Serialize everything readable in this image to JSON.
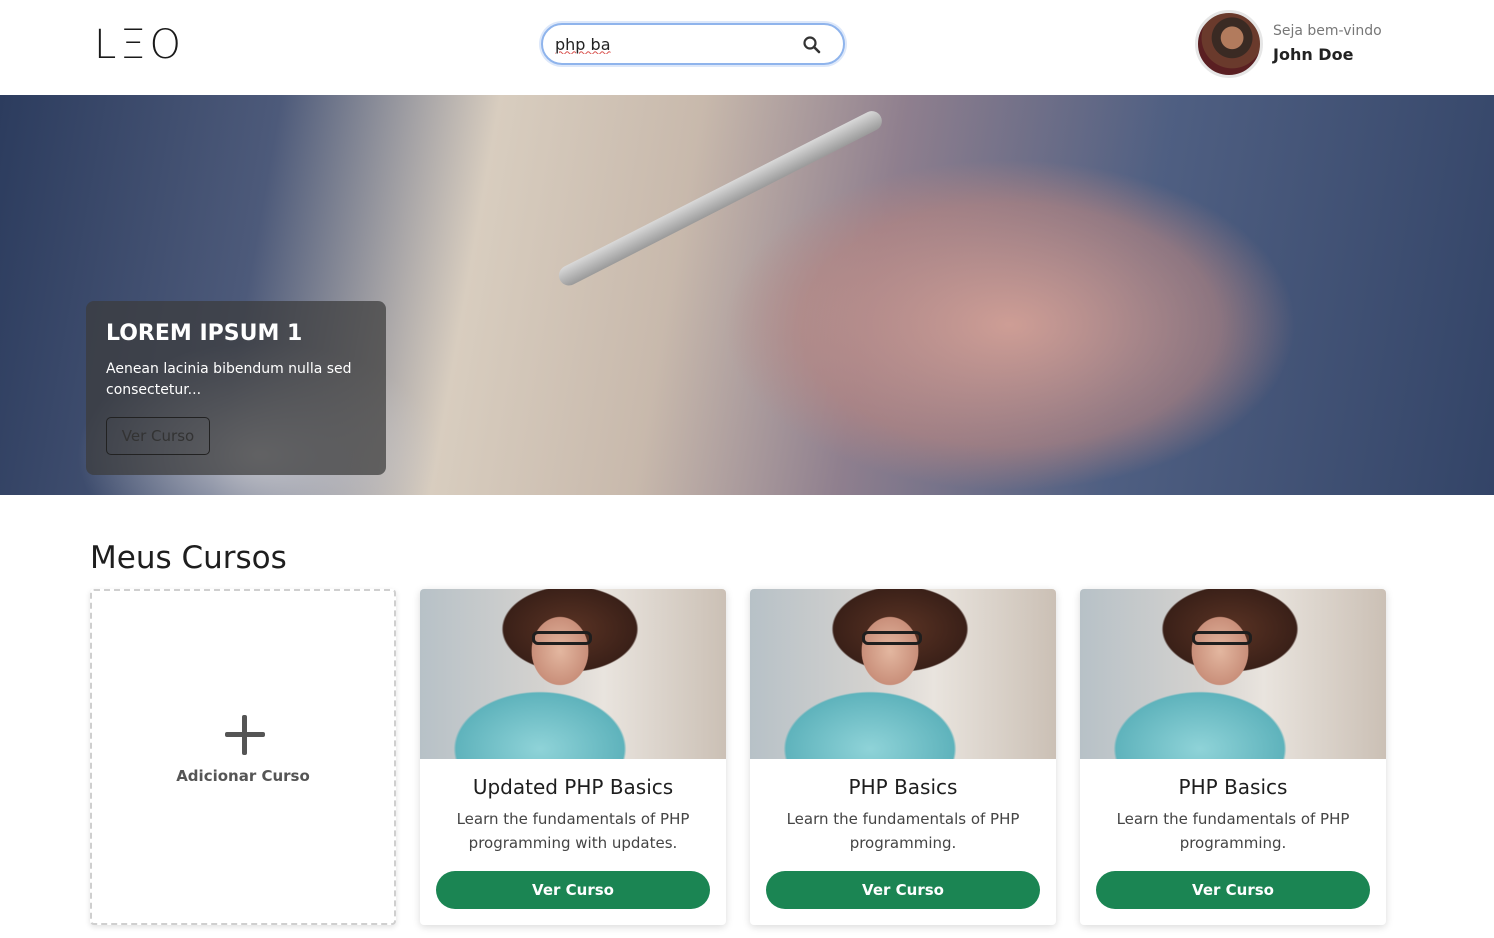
{
  "header": {
    "logo": "LΞO",
    "search": {
      "value": "php ba",
      "placeholder": ""
    },
    "user": {
      "welcome": "Seja bem-vindo",
      "name": "John Doe"
    }
  },
  "hero": {
    "title": "LOREM IPSUM 1",
    "description": "Aenean lacinia bibendum nulla sed consectetur...",
    "button": "Ver Curso"
  },
  "section": {
    "title": "Meus Cursos"
  },
  "add_card": {
    "label": "Adicionar Curso"
  },
  "courses": [
    {
      "title": "Updated PHP Basics",
      "description": "Learn the fundamentals of PHP programming with updates.",
      "button": "Ver Curso"
    },
    {
      "title": "PHP Basics",
      "description": "Learn the fundamentals of PHP programming.",
      "button": "Ver Curso"
    },
    {
      "title": "PHP Basics",
      "description": "Learn the fundamentals of PHP programming.",
      "button": "Ver Curso"
    }
  ],
  "colors": {
    "primary_button": "#1b8553",
    "search_border": "#8fb4ec"
  },
  "icons": {
    "search": "search-icon",
    "add": "plus-icon"
  }
}
